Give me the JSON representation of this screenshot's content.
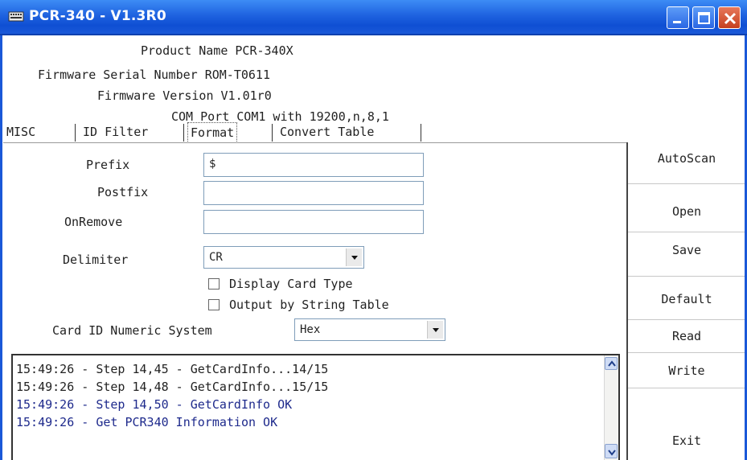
{
  "window": {
    "title": "PCR-340 - V1.3R0",
    "title_bar_color": "#1f63e0",
    "controls": [
      "minimize-icon",
      "maximize-icon",
      "close-icon"
    ]
  },
  "info": {
    "product_name": "Product Name PCR-340X",
    "serial_number": "Firmware Serial Number ROM-T0611",
    "firmware_version": "Firmware Version V1.01r0",
    "com_port": "COM Port COM1 with 19200,n,8,1"
  },
  "tabs": [
    {
      "label": "MISC"
    },
    {
      "label": "ID Filter"
    },
    {
      "label": "Format",
      "selected": true
    },
    {
      "label": "Convert Table"
    }
  ],
  "format": {
    "prefix_label": "Prefix",
    "prefix_value": "$",
    "postfix_label": "Postfix",
    "postfix_value": "",
    "onremove_label": "OnRemove",
    "onremove_value": "",
    "delimiter_label": "Delimiter",
    "delimiter_value": "CR",
    "display_card_type_label": "Display Card Type",
    "display_card_type_checked": false,
    "output_by_string_label": "Output by String Table",
    "output_by_string_checked": false,
    "numeric_system_label": "Card ID Numeric System",
    "numeric_system_value": "Hex"
  },
  "log": {
    "lines": [
      "15:49:26 - Step 14,45 - GetCardInfo...14/15",
      "15:49:26 - Step 14,48 - GetCardInfo...15/15",
      "15:49:26 - Step 14,50 - GetCardInfo OK",
      "15:49:26 - Get PCR340 Information OK"
    ],
    "highlight_color": "#1e2a8c"
  },
  "buttons": {
    "autoscan": "AutoScan",
    "open": "Open",
    "save": "Save",
    "default": "Default",
    "read": "Read",
    "write": "Write",
    "exit": "Exit"
  }
}
